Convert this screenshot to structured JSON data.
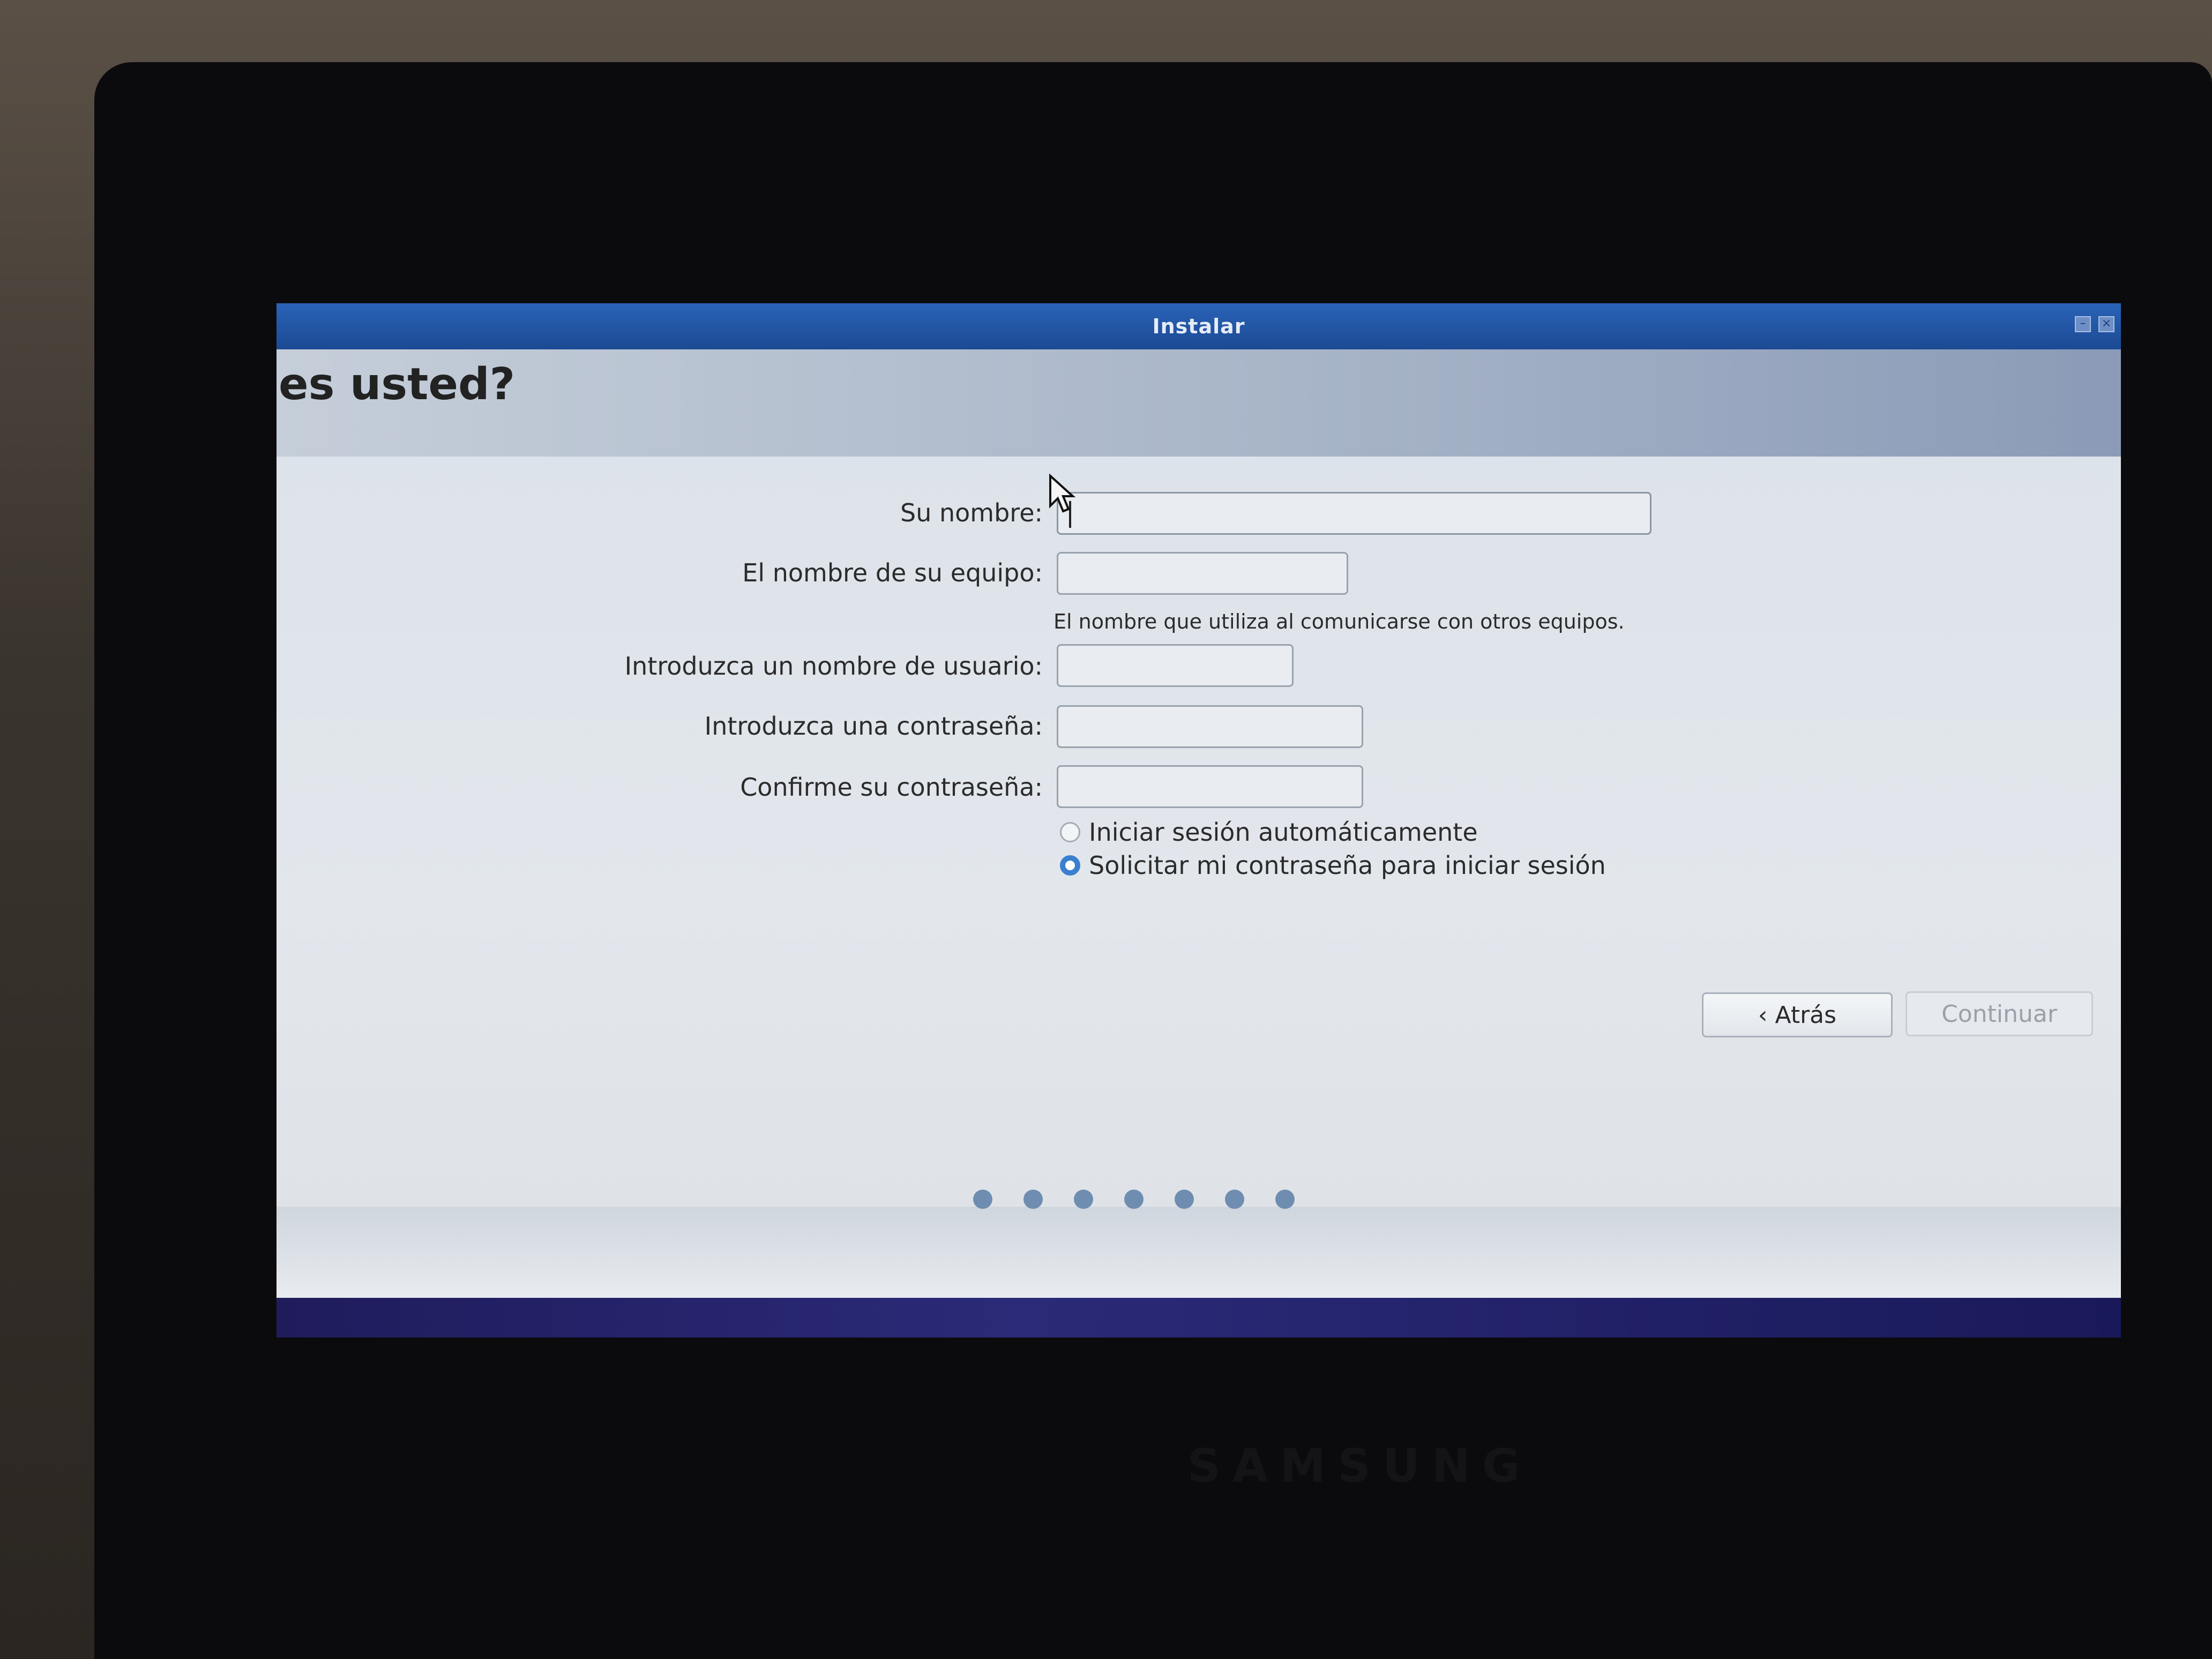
{
  "window": {
    "title": "Instalar",
    "controls": [
      "minimize-icon",
      "close-icon"
    ]
  },
  "page": {
    "heading": "es usted?"
  },
  "form": {
    "name_label": "Su nombre:",
    "name_value": "",
    "computer_label": "El nombre de su equipo:",
    "computer_value": "",
    "computer_hint": "El nombre que utiliza al comunicarse con otros equipos.",
    "username_label": "Introduzca un nombre de usuario:",
    "username_value": "",
    "password_label": "Introduzca una contraseña:",
    "password_value": "",
    "confirm_label": "Confirme su contraseña:",
    "confirm_value": ""
  },
  "login_options": {
    "auto_login_label": "Iniciar sesión automáticamente",
    "auto_login_selected": false,
    "require_password_label": "Solicitar mi contraseña para iniciar sesión",
    "require_password_selected": true
  },
  "buttons": {
    "back_label": "Atrás",
    "back_icon": "chevron-left-icon",
    "continue_label": "Continuar",
    "continue_enabled": false
  },
  "progress": {
    "total_steps": 7
  },
  "device": {
    "brand": "SAMSUNG"
  },
  "colors": {
    "titlebar": "#1c4a94",
    "accent": "#3b7fd0"
  }
}
